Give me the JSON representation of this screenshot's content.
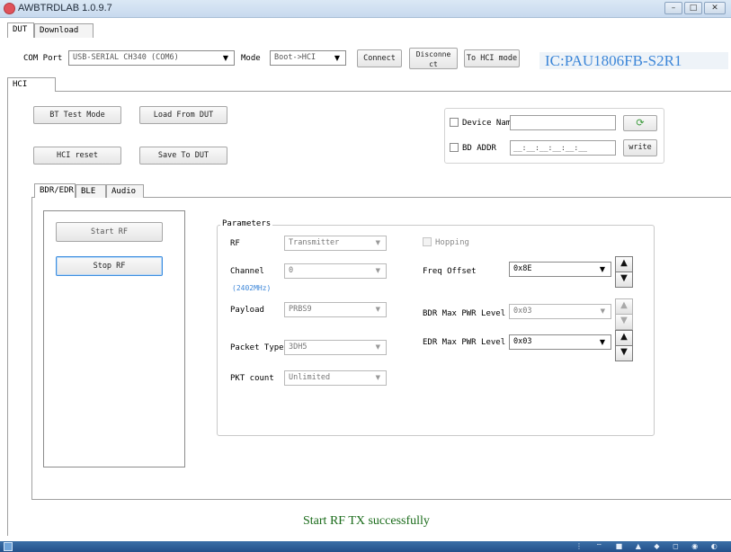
{
  "window": {
    "title": "AWBTRDLAB 1.0.9.7",
    "min": "–",
    "max": "□",
    "close": "✕"
  },
  "top_tabs": [
    "DUT",
    "Download"
  ],
  "toolbar": {
    "com_label": "COM Port",
    "com_value": "USB-SERIAL CH340 (COM6)",
    "mode_label": "Mode",
    "mode_value": "Boot->HCI",
    "connect": "Connect",
    "disconnect": "Disconnect",
    "hci_mode": "To HCI mode",
    "ic_chip": "IC:PAU1806FB-S2R1"
  },
  "sub_tab": "HCI",
  "hci_buttons": {
    "bt_test_mode": "BT Test Mode",
    "load_from_dut": "Load From DUT",
    "hci_reset": "HCI reset",
    "save_to_dut": "Save To DUT"
  },
  "device_panel": {
    "device_name_label": "Device Name",
    "device_name_value": "",
    "bd_addr_label": "BD ADDR",
    "bd_addr_value": "__:__:__:__:__:__",
    "write": "write"
  },
  "rf_tabs": [
    "BDR/EDR",
    "BLE",
    "Audio"
  ],
  "rf_buttons": {
    "start": "Start RF",
    "stop": "Stop RF"
  },
  "params": {
    "title": "Parameters",
    "rf_label": "RF",
    "rf_value": "Transmitter",
    "hopping_label": "Hopping",
    "channel_label": "Channel",
    "channel_value": "0",
    "channel_freq": "(2402MHz)",
    "freq_offset_label": "Freq Offset",
    "freq_offset_value": "0x8E",
    "payload_label": "Payload",
    "payload_value": "PRBS9",
    "bdr_pwr_label": "BDR Max PWR Level",
    "bdr_pwr_value": "0x03",
    "packet_type_label": "Packet Type",
    "packet_type_value": "3DH5",
    "edr_pwr_label": "EDR Max PWR Level",
    "edr_pwr_value": "0x03",
    "pkt_count_label": "PKT count",
    "pkt_count_value": "Unlimited"
  },
  "status": "Start RF TX successfully",
  "colors": {
    "accent": "#3c86d8",
    "status": "#1a6b1a",
    "focus": "#3d8ee0"
  }
}
